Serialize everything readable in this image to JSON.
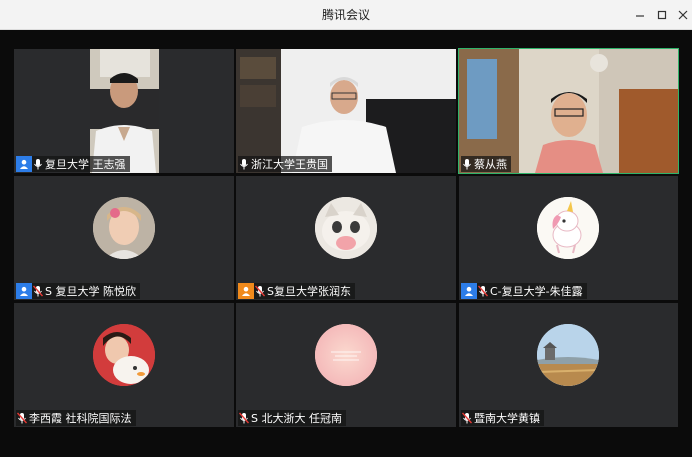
{
  "window": {
    "title": "腾讯会议"
  },
  "tiles": [
    {
      "name": "复旦大学 王志强"
    },
    {
      "name": "浙江大学王贵国"
    },
    {
      "name": "蔡从燕"
    },
    {
      "name": "S 复旦大学 陈悦欣"
    },
    {
      "name": "S复旦大学张润东"
    },
    {
      "name": "C-复旦大学-朱佳露"
    },
    {
      "name": "李西霞 社科院国际法"
    },
    {
      "name": "S 北大浙大 任冠南"
    },
    {
      "name": "暨南大学黄镇"
    }
  ],
  "colors": {
    "host_badge": "#2d7de8",
    "orange_badge": "#f08a1c",
    "active_speaker": "#2fb46b",
    "tile_bg": "#2a2b2d"
  }
}
